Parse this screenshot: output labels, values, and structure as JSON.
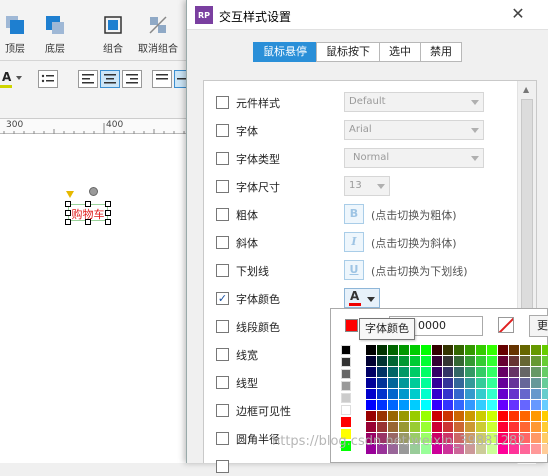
{
  "toolbar": {
    "buttons": [
      {
        "label": "顶层"
      },
      {
        "label": "底层"
      },
      {
        "label": "组合"
      },
      {
        "label": "取消组合"
      }
    ],
    "font_color_letter": "A"
  },
  "ruler": {
    "ticks": [
      "300",
      "400"
    ]
  },
  "canvas": {
    "widget_text": "购物车"
  },
  "dialog": {
    "logo": "RP",
    "title": "交互样式设置",
    "close": "✕",
    "tabs": [
      {
        "label": "鼠标悬停",
        "active": true
      },
      {
        "label": "鼠标按下",
        "active": false
      },
      {
        "label": "选中",
        "active": false
      },
      {
        "label": "禁用",
        "active": false
      }
    ],
    "rows": [
      {
        "label": "元件样式",
        "checked": false,
        "control": "select",
        "value": "Default"
      },
      {
        "label": "字体",
        "checked": false,
        "control": "select",
        "value": "Arial"
      },
      {
        "label": "字体类型",
        "checked": false,
        "control": "select",
        "value": "Normal"
      },
      {
        "label": "字体尺寸",
        "checked": false,
        "control": "select-small",
        "value": "13"
      },
      {
        "label": "粗体",
        "checked": false,
        "control": "format",
        "glyph": "B",
        "hint": "(点击切换为粗体)"
      },
      {
        "label": "斜体",
        "checked": false,
        "control": "format",
        "glyph": "I",
        "hint": "(点击切换为斜体)"
      },
      {
        "label": "下划线",
        "checked": false,
        "control": "format",
        "glyph": "U",
        "hint": "(点击切换为下划线)"
      },
      {
        "label": "字体颜色",
        "checked": true,
        "control": "color",
        "glyph": "A"
      },
      {
        "label": "线段颜色",
        "checked": false,
        "control": "none"
      },
      {
        "label": "线宽",
        "checked": false,
        "control": "none"
      },
      {
        "label": "线型",
        "checked": false,
        "control": "none"
      },
      {
        "label": "边框可见性",
        "checked": false,
        "control": "none"
      },
      {
        "label": "圆角半径",
        "checked": false,
        "control": "none"
      }
    ]
  },
  "picker": {
    "current_color": "#ff0000",
    "hex_value": "0000",
    "more_label": "更",
    "tooltip": "字体颜色",
    "gray_swatches": [
      "#000000",
      "#333333",
      "#666666",
      "#999999",
      "#cccccc",
      "#ffffff"
    ],
    "standard_swatches": [
      "#ff0000",
      "#ffff00",
      "#00ff00"
    ]
  },
  "watermark": "https://blog.csdn.net/weixin_39881282"
}
